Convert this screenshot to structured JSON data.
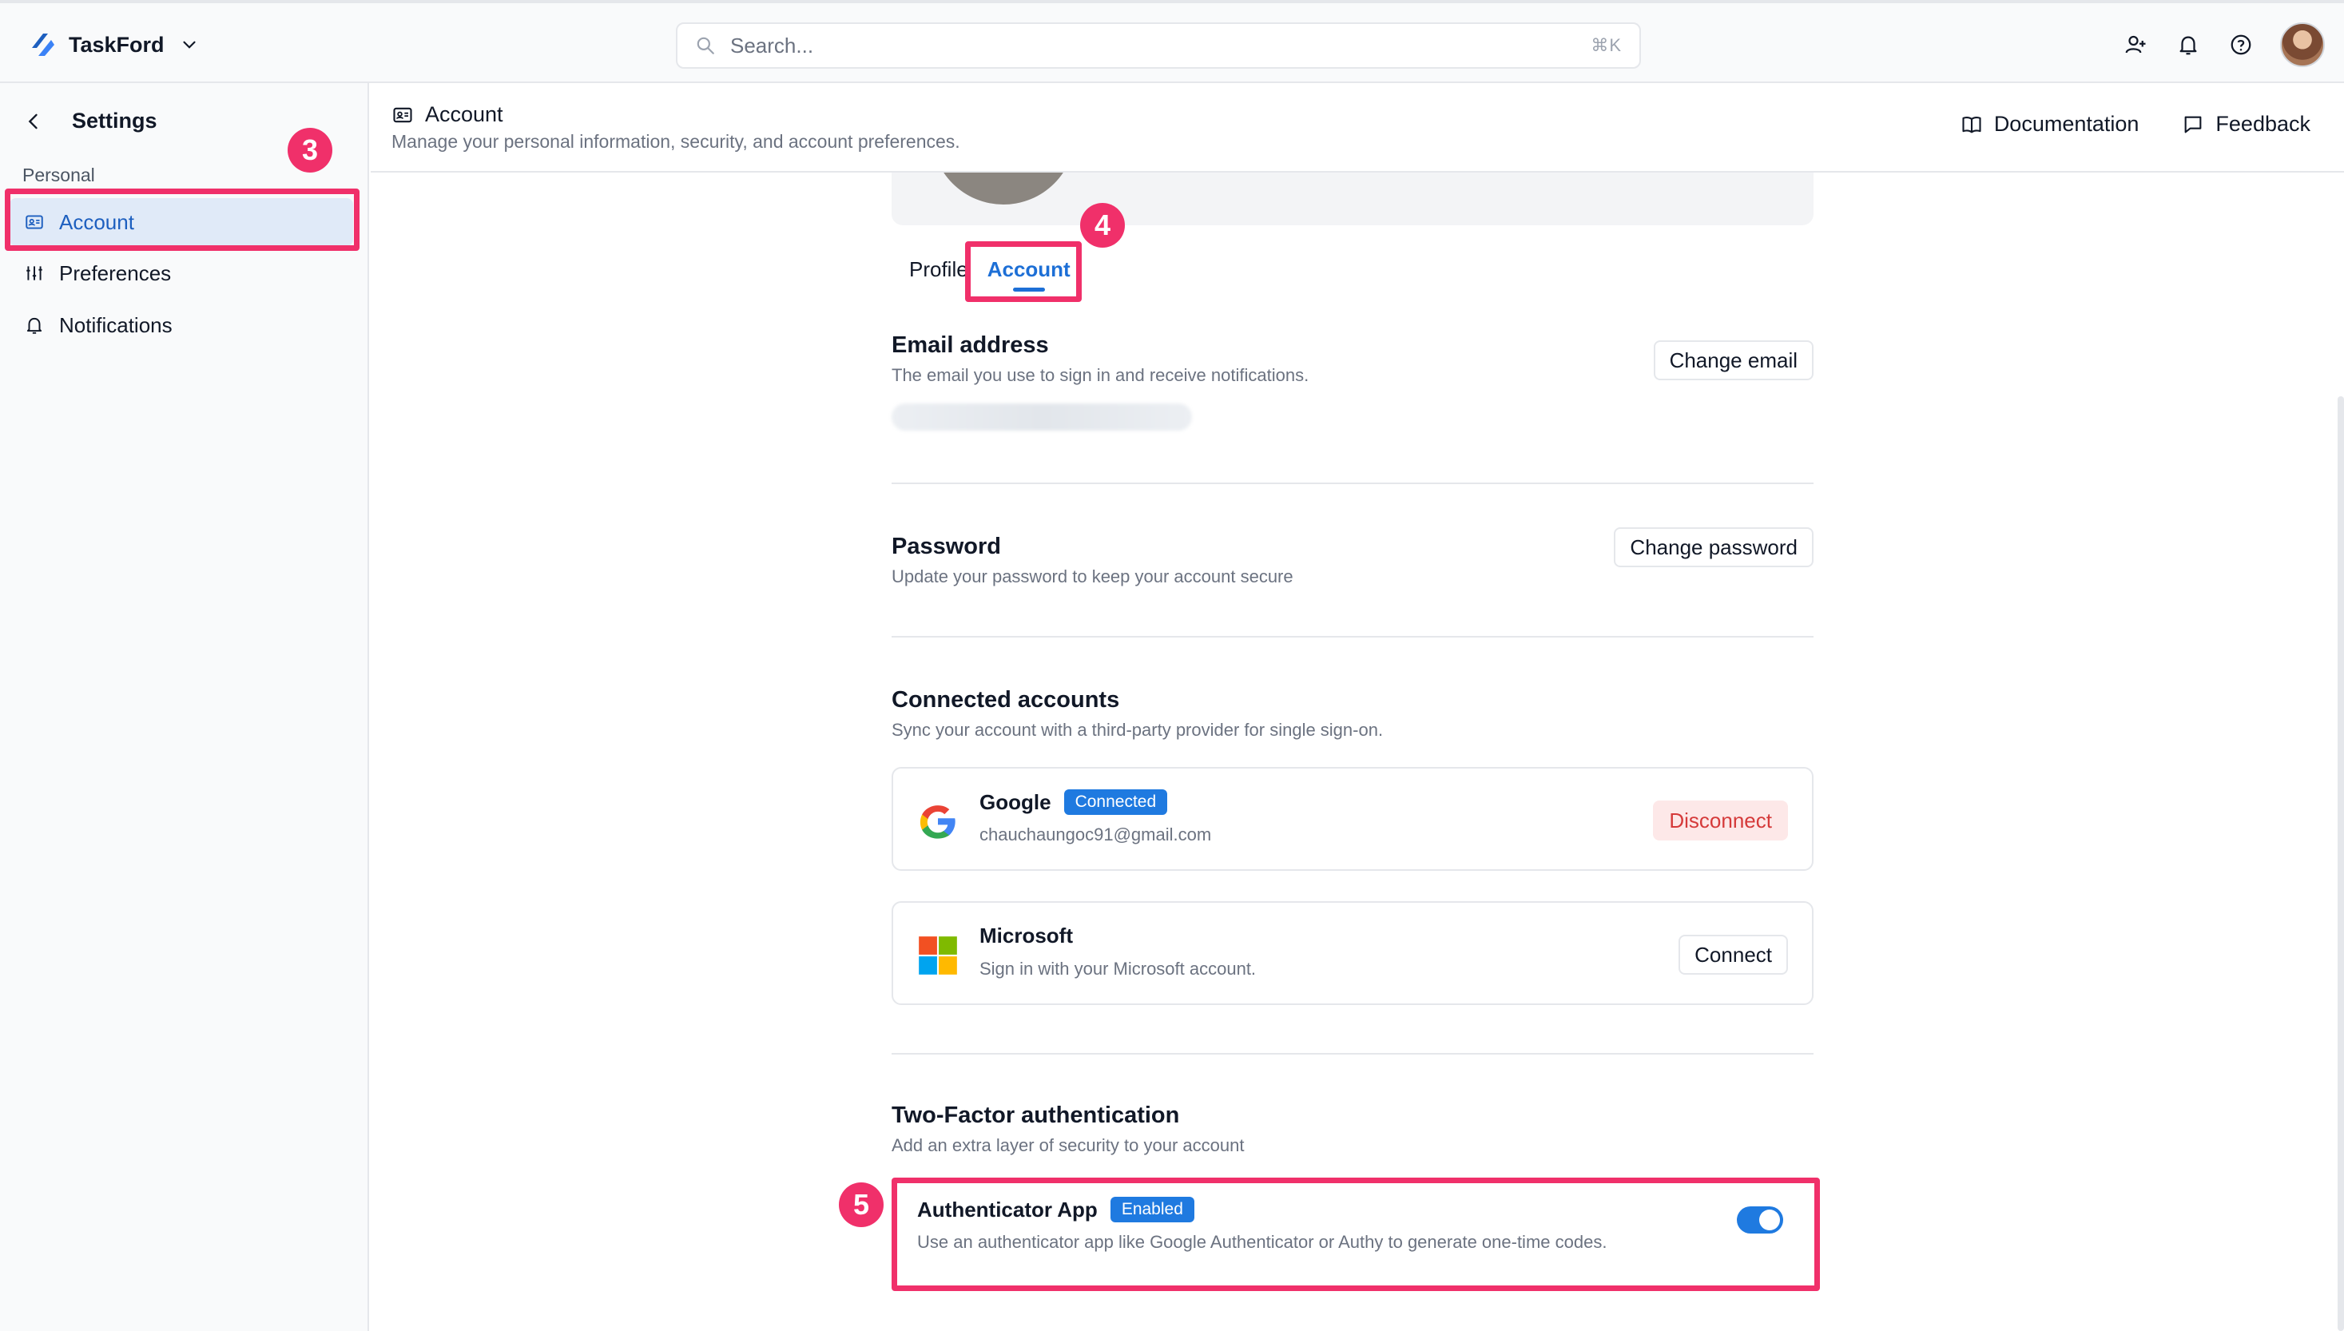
{
  "app": {
    "name": "TaskFord"
  },
  "search": {
    "placeholder": "Search...",
    "shortcut": "⌘K"
  },
  "topbar_icons": [
    "add-user-icon",
    "bell-icon",
    "help-icon"
  ],
  "sidebar": {
    "title": "Settings",
    "section_label": "Personal",
    "items": [
      {
        "label": "Account",
        "icon": "id-card-icon",
        "active": true
      },
      {
        "label": "Preferences",
        "icon": "sliders-icon",
        "active": false
      },
      {
        "label": "Notifications",
        "icon": "bell-icon",
        "active": false
      }
    ]
  },
  "page_header": {
    "title": "Account",
    "subtitle": "Manage your personal information, security, and account preferences.",
    "links": [
      {
        "label": "Documentation",
        "icon": "book-icon"
      },
      {
        "label": "Feedback",
        "icon": "message-icon"
      }
    ]
  },
  "tabs": [
    {
      "label": "Profile",
      "active": false
    },
    {
      "label": "Account",
      "active": true
    }
  ],
  "email": {
    "title": "Email address",
    "description": "The email you use to sign in and receive notifications.",
    "button": "Change email"
  },
  "password": {
    "title": "Password",
    "description": "Update your password to keep your account secure",
    "button": "Change password"
  },
  "connected_accounts": {
    "title": "Connected accounts",
    "description": "Sync your account with a third-party provider for single sign-on.",
    "providers": [
      {
        "name": "Google",
        "badge": "Connected",
        "detail": "chauchaungoc91@gmail.com",
        "action": "Disconnect"
      },
      {
        "name": "Microsoft",
        "badge": "",
        "detail": "Sign in with your Microsoft account.",
        "action": "Connect"
      }
    ]
  },
  "two_factor": {
    "title": "Two-Factor authentication",
    "description": "Add an extra layer of security to your account",
    "app_name": "Authenticator App",
    "badge": "Enabled",
    "app_description": "Use an authenticator app like Google Authenticator or Authy to generate one-time codes.",
    "enabled": true
  },
  "annotations": {
    "marker_3": "3",
    "marker_4": "4",
    "marker_5": "5"
  },
  "colors": {
    "accent": "#1f7ae0",
    "highlight": "#f0306a",
    "danger": "#d53a3a"
  }
}
